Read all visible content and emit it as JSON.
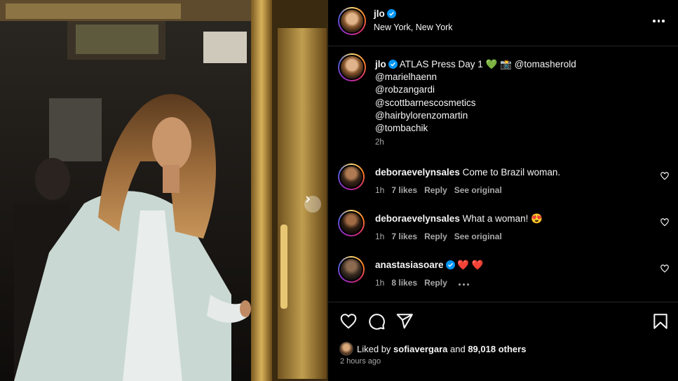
{
  "post": {
    "username": "jlo",
    "location": "New York, New York"
  },
  "caption": {
    "username": "jlo",
    "text": "ATLAS Press Day 1",
    "emoji": "💚 📸",
    "first_mention": "@tomasherold",
    "mentions": [
      "@marielhaenn",
      "@robzangardi",
      "@scottbarnescosmetics",
      "@hairbylorenzomartin",
      "@tombachik"
    ],
    "time": "2h"
  },
  "comments": [
    {
      "username": "deboraevelynsales",
      "text": "Come to Brazil woman.",
      "time": "1h",
      "likes": "7 likes",
      "reply": "Reply",
      "extra": "See original",
      "verified": false
    },
    {
      "username": "deboraevelynsales",
      "text": "What a woman! 😍",
      "time": "1h",
      "likes": "7 likes",
      "reply": "Reply",
      "extra": "See original",
      "verified": false
    },
    {
      "username": "anastasiasoare",
      "text": "❤️ ❤️",
      "time": "1h",
      "likes": "8 likes",
      "reply": "Reply",
      "extra": "",
      "verified": true
    }
  ],
  "likes": {
    "prefix": "Liked by",
    "user": "sofiavergara",
    "middle": "and",
    "count": "89,018 others"
  },
  "post_time": "2 hours ago",
  "colors": {
    "background": "#000000",
    "text": "#f5f5f5",
    "secondary": "#a8a8a8",
    "verified": "#0095f6",
    "divider": "#262626"
  },
  "icons": {
    "like": "heart-icon",
    "comment": "comment-icon",
    "share": "paper-plane-icon",
    "save": "bookmark-icon",
    "more": "more-horizontal-icon",
    "carousel": "chevron-right-icon"
  }
}
